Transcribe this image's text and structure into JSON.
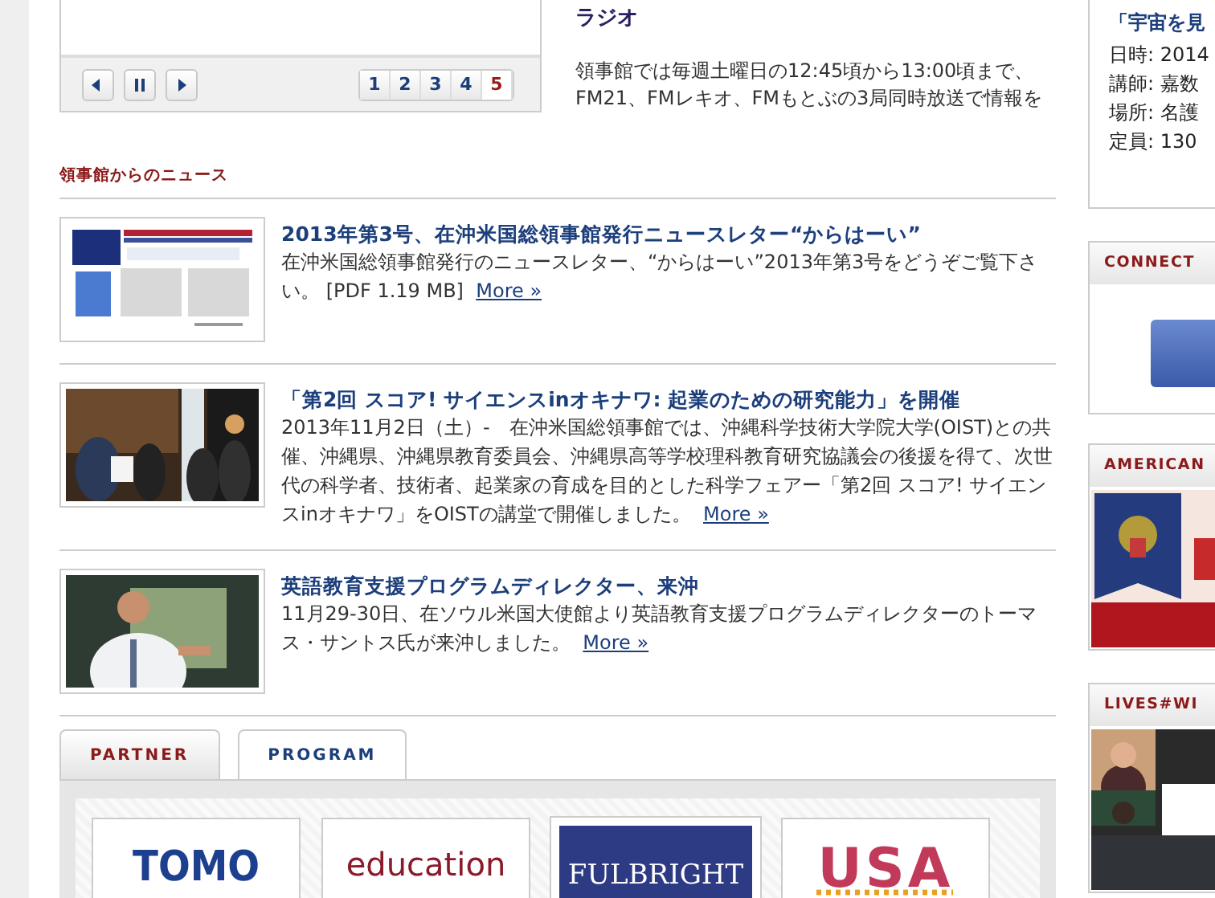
{
  "slideshow": {
    "pages": [
      {
        "label": "1",
        "selected": false
      },
      {
        "label": "2",
        "selected": false
      },
      {
        "label": "3",
        "selected": false
      },
      {
        "label": "4",
        "selected": false
      },
      {
        "label": "5",
        "selected": true
      }
    ]
  },
  "feature": {
    "title": "ラジオ",
    "text": "領事館では毎週土曜日の12:45頃から13:00頃まで、FM21、FMレキオ、FMもとぶの3局同時放送で情報を"
  },
  "event": {
    "title": "「宇宙を見",
    "lines": [
      "日時: 2014",
      "講師: 嘉数",
      "場所: 名護",
      "定員: 130"
    ]
  },
  "news": {
    "heading": "領事館からのニュース",
    "items": [
      {
        "kind": "newsletter",
        "title": "2013年第3号、在沖米国総領事館発行ニュースレター“からはーい”",
        "text": "在沖米国総領事館発行のニュースレター、“からはーい”2013年第3号をどうぞご覧下さい。 [PDF 1.19 MB]",
        "more": "More »"
      },
      {
        "kind": "ceremony",
        "title": "「第2回 スコア! サイエンスinオキナワ: 起業のための研究能力」を開催",
        "text": "2013年11月2日（土）-　在沖米国総領事館では、沖縄科学技術大学院大学(OIST)との共催、沖縄県、沖縄県教育委員会、沖縄県高等学校理科教育研究協議会の後援を得て、次世代の科学者、技術者、起業家の育成を目的とした科学フェアー「第2回 スコア! サイエンスinオキナワ」をOISTの講堂で開催しました。",
        "more": "More »"
      },
      {
        "kind": "speaker",
        "title": "英語教育支援プログラムディレクター、来沖",
        "text": "11月29-30日、在ソウル米国大使館より英語教育支援プログラムディレクターのトーマス・サントス氏が来沖しました。",
        "more": "More »"
      }
    ]
  },
  "tabs": [
    {
      "label": "PARTNER",
      "selected": true
    },
    {
      "label": "PROGRAM",
      "selected": false
    }
  ],
  "partners": [
    {
      "kind": "tomodachi",
      "lines": [
        "TOMO"
      ]
    },
    {
      "kind": "education",
      "lines": [
        "education"
      ]
    },
    {
      "kind": "fulbright",
      "lines": [
        "FULBRIGHT"
      ]
    },
    {
      "kind": "usa",
      "lines": [
        "USA"
      ]
    }
  ],
  "widgets": [
    {
      "kind": "connect",
      "heading": "CONNECT"
    },
    {
      "kind": "american",
      "heading": "AMERICAN"
    },
    {
      "kind": "lives",
      "heading": "LIVES#WI"
    }
  ]
}
